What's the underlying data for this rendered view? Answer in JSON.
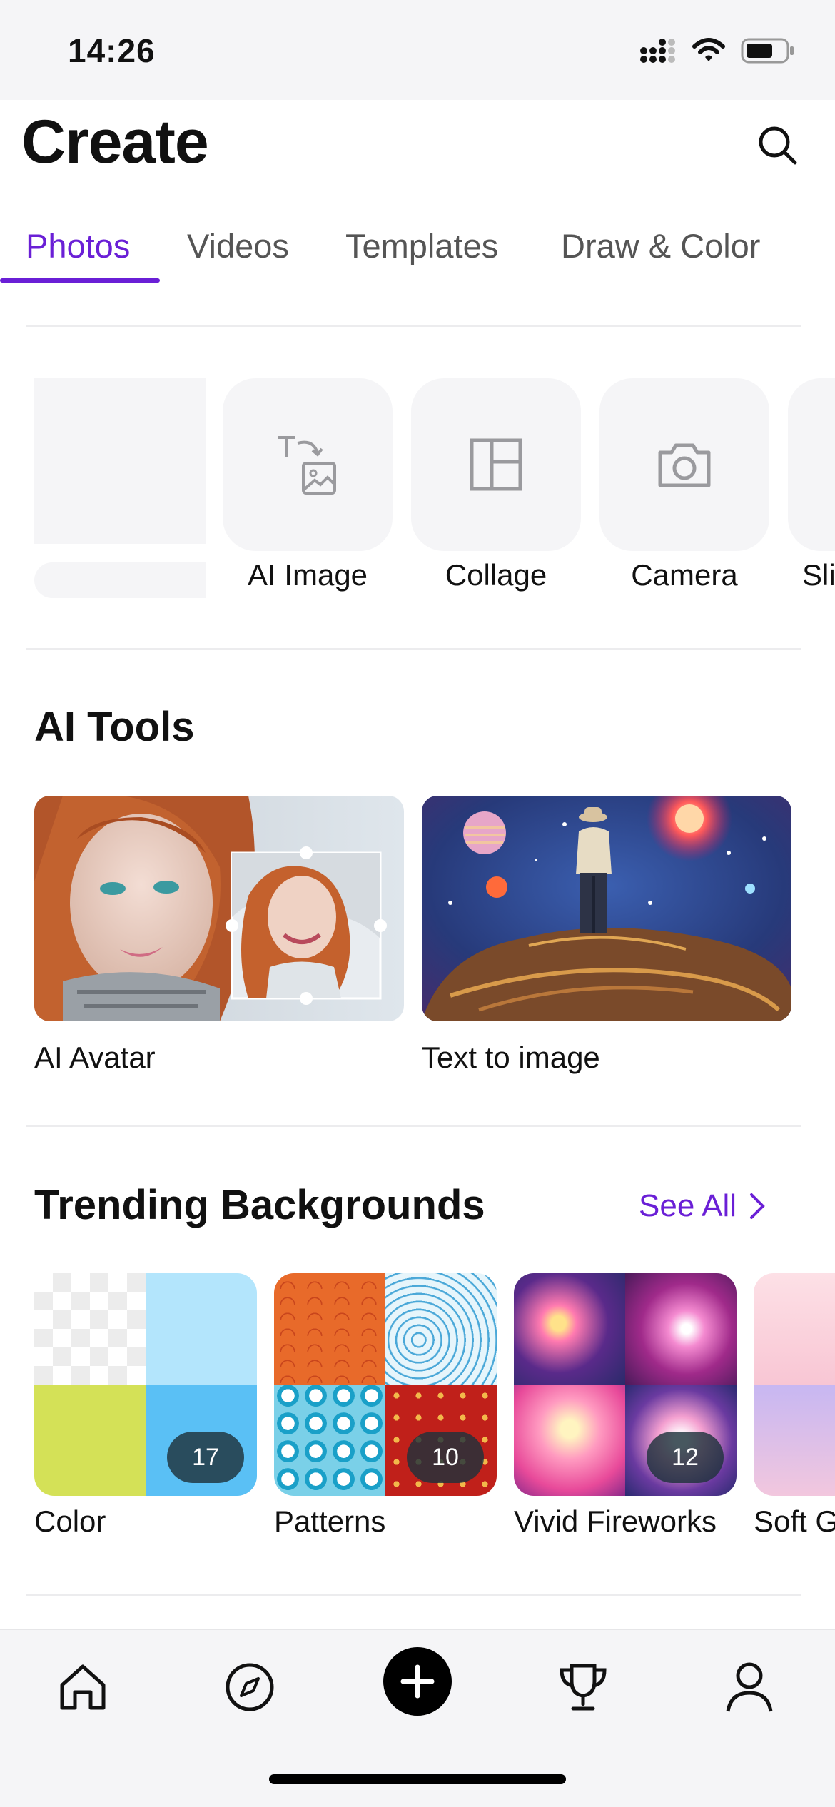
{
  "status_bar": {
    "time": "14:26"
  },
  "header": {
    "title": "Create"
  },
  "tabs": [
    {
      "label": "Photos",
      "active": true
    },
    {
      "label": "Videos",
      "active": false
    },
    {
      "label": "Templates",
      "active": false
    },
    {
      "label": "Draw & Color",
      "active": false
    }
  ],
  "quick_tools": [
    {
      "label": "AI Image",
      "icon": "text-to-image-icon"
    },
    {
      "label": "Collage",
      "icon": "collage-icon"
    },
    {
      "label": "Camera",
      "icon": "camera-icon"
    },
    {
      "label": "Sli"
    }
  ],
  "ai_tools": {
    "title": "AI Tools",
    "items": [
      {
        "label": "AI Avatar"
      },
      {
        "label": "Text to image"
      }
    ]
  },
  "trending": {
    "title": "Trending Backgrounds",
    "see_all": "See All",
    "items": [
      {
        "label": "Color",
        "count": "17"
      },
      {
        "label": "Patterns",
        "count": "10"
      },
      {
        "label": "Vivid Fireworks",
        "count": "12"
      },
      {
        "label": "Soft G"
      }
    ]
  },
  "colors": {
    "accent": "#6a1fd6",
    "tile_bg": "#f5f5f7"
  }
}
